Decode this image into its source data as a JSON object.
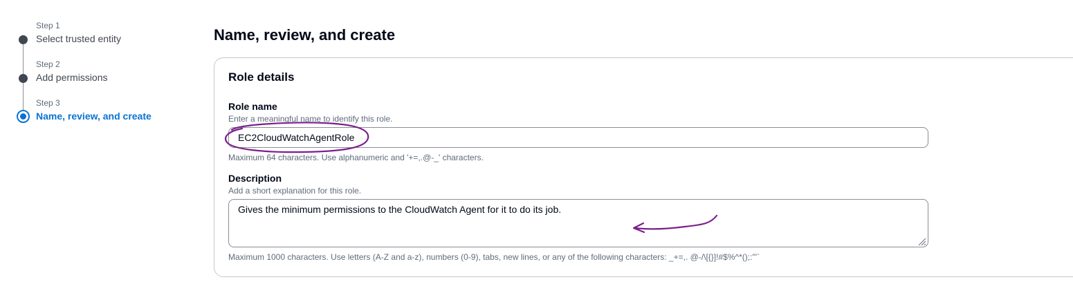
{
  "steps": [
    {
      "step": "Step 1",
      "label": "Select trusted entity"
    },
    {
      "step": "Step 2",
      "label": "Add permissions"
    },
    {
      "step": "Step 3",
      "label": "Name, review, and create"
    }
  ],
  "active_step": 3,
  "page_title": "Name, review, and create",
  "role_details": {
    "header": "Role details",
    "role_name": {
      "label": "Role name",
      "description": "Enter a meaningful name to identify this role.",
      "value": "EC2CloudWatchAgentRole",
      "constraint": "Maximum 64 characters. Use alphanumeric and '+=,.@-_' characters."
    },
    "description": {
      "label": "Description",
      "description": "Add a short explanation for this role.",
      "value": "Gives the minimum permissions to the CloudWatch Agent for it to do its job.",
      "constraint": "Maximum 1000 characters. Use letters (A-Z and a-z), numbers (0-9), tabs, new lines, or any of the following characters: _+=,. @-/\\[{}]!#$%^*();:\"'`"
    }
  },
  "colors": {
    "accent": "#0972d3",
    "annotation": "#7b1f8c"
  },
  "icons": [
    "step-complete-icon",
    "step-active-icon",
    "resize-grip-icon"
  ]
}
